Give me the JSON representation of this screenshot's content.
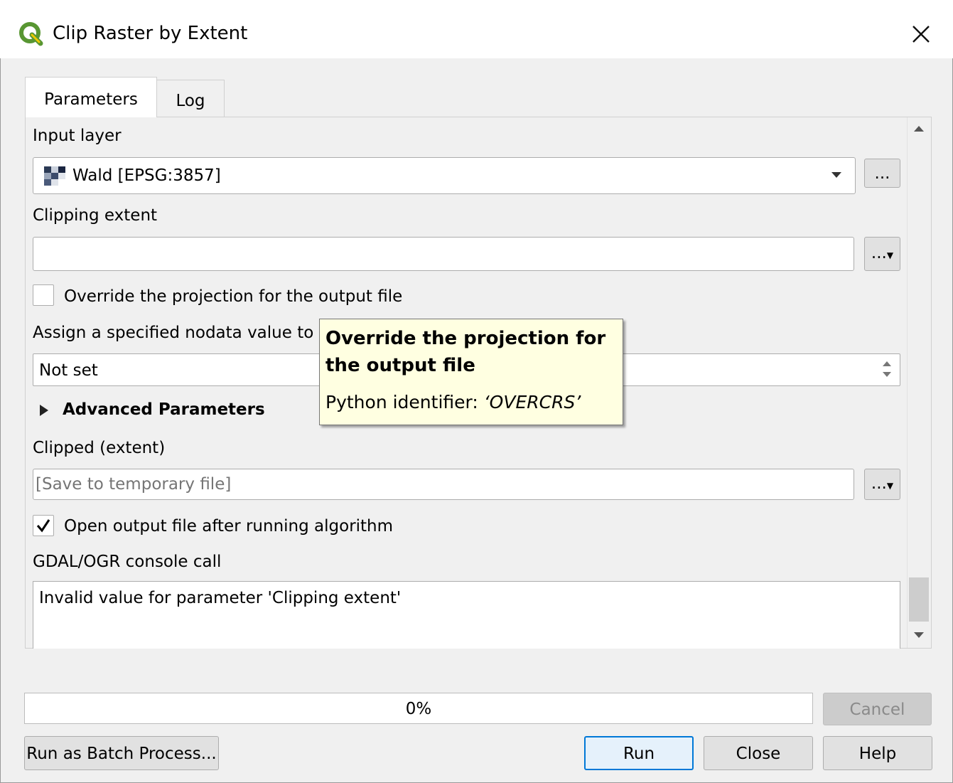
{
  "window": {
    "title": "Clip Raster by Extent",
    "app_icon": "qgis-icon",
    "close_icon": "close-icon"
  },
  "tabs": [
    {
      "label": "Parameters",
      "active": true
    },
    {
      "label": "Log",
      "active": false
    }
  ],
  "parameters": {
    "input_layer": {
      "label": "Input layer",
      "value": "Wald [EPSG:3857]",
      "browse_label": "..."
    },
    "clipping_extent": {
      "label": "Clipping extent",
      "value": "",
      "browse_label": "..."
    },
    "override_projection": {
      "label": "Override the projection for the output file",
      "checked": false
    },
    "nodata": {
      "label": "Assign a specified nodata value to ou",
      "value": "Not set"
    },
    "advanced": {
      "label": "Advanced Parameters",
      "expanded": false
    },
    "clipped_output": {
      "label": "Clipped (extent)",
      "placeholder": "[Save to temporary file]",
      "browse_label": "..."
    },
    "open_output": {
      "label": "Open output file after running algorithm",
      "checked": true
    },
    "console": {
      "label": "GDAL/OGR console call",
      "text": "Invalid value for parameter 'Clipping extent'"
    }
  },
  "tooltip": {
    "title": "Override the projection for the output file",
    "python_prefix": "Python identifier: ",
    "python_identifier": "‘OVERCRS’"
  },
  "progress": {
    "value": 0,
    "text": "0%"
  },
  "buttons": {
    "cancel": "Cancel",
    "batch": "Run as Batch Process...",
    "run": "Run",
    "close": "Close",
    "help": "Help"
  },
  "colors": {
    "dialog_bg": "#f0f0f0",
    "tooltip_bg": "#ffffe1",
    "run_border": "#0078d7",
    "qgis_green": "#589632",
    "qgis_yellow": "#eec900"
  }
}
